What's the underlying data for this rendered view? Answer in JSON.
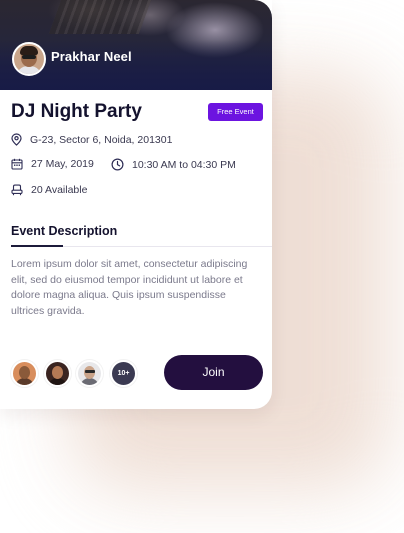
{
  "host": {
    "name": "Prakhar Neel"
  },
  "event": {
    "title": "DJ Night Party",
    "badge": "Free Event",
    "address": "G-23, Sector 6, Noida, 201301",
    "date": "27 May, 2019",
    "time": "10:30 AM to 04:30 PM",
    "seats": "20 Available"
  },
  "description": {
    "heading": "Event Description",
    "body": "Lorem ipsum dolor sit amet, consectetur adipiscing elit, sed do eiusmod tempor incididunt ut labore et dolore magna aliqua. Quis ipsum suspendisse ultrices gravida."
  },
  "attendees": {
    "more_label": "10+"
  },
  "actions": {
    "join_label": "Join"
  },
  "colors": {
    "accent": "#6c14e0",
    "button": "#230f3f",
    "title_text": "#14122e",
    "body_text": "#7b7a8c",
    "hero_overlay": "#1b1f45",
    "glow": "#ecd9ce"
  },
  "icons": {
    "address": "location-pin-icon",
    "date": "calendar-icon",
    "time": "clock-icon",
    "seats": "seat-icon"
  }
}
